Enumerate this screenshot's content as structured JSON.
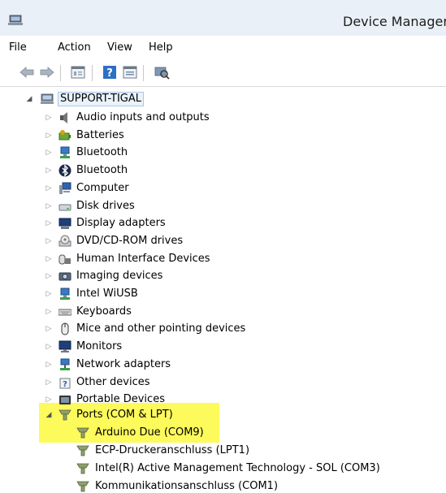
{
  "window": {
    "title": "Device Manager"
  },
  "menu": [
    "File",
    "Action",
    "View",
    "Help"
  ],
  "toolbar": {
    "buttons": [
      "back-icon",
      "forward-icon",
      "properties-icon",
      "help-icon",
      "update-driver-icon",
      "scan-hardware-icon"
    ]
  },
  "tree": {
    "root": "SUPPORT-TIGAL",
    "categories": [
      {
        "label": "Audio inputs and outputs",
        "icon": "speaker-icon"
      },
      {
        "label": "Batteries",
        "icon": "battery-icon"
      },
      {
        "label": "Bluetooth",
        "icon": "network-device-icon"
      },
      {
        "label": "Bluetooth",
        "icon": "bluetooth-icon"
      },
      {
        "label": "Computer",
        "icon": "computer-icon"
      },
      {
        "label": "Disk drives",
        "icon": "disk-drive-icon"
      },
      {
        "label": "Display adapters",
        "icon": "display-adapter-icon"
      },
      {
        "label": "DVD/CD-ROM drives",
        "icon": "optical-drive-icon"
      },
      {
        "label": "Human Interface Devices",
        "icon": "hid-icon"
      },
      {
        "label": "Imaging devices",
        "icon": "camera-icon"
      },
      {
        "label": "Intel WiUSB",
        "icon": "network-device-icon"
      },
      {
        "label": "Keyboards",
        "icon": "keyboard-icon"
      },
      {
        "label": "Mice and other pointing devices",
        "icon": "mouse-icon"
      },
      {
        "label": "Monitors",
        "icon": "monitor-icon"
      },
      {
        "label": "Network adapters",
        "icon": "network-adapter-icon"
      },
      {
        "label": "Other devices",
        "icon": "unknown-device-icon"
      },
      {
        "label": "Portable Devices",
        "icon": "portable-device-icon"
      }
    ],
    "ports": {
      "label": "Ports (COM & LPT)",
      "children": [
        "Arduino Due (COM9)",
        "ECP-Druckeranschluss (LPT1)",
        "Intel(R) Active Management Technology - SOL (COM3)",
        "Kommunikationsanschluss (COM1)"
      ]
    }
  },
  "colors": {
    "highlight": "#fdfa5c",
    "titlebar": "#e9f0f7",
    "selection": "#eaf2fb"
  }
}
